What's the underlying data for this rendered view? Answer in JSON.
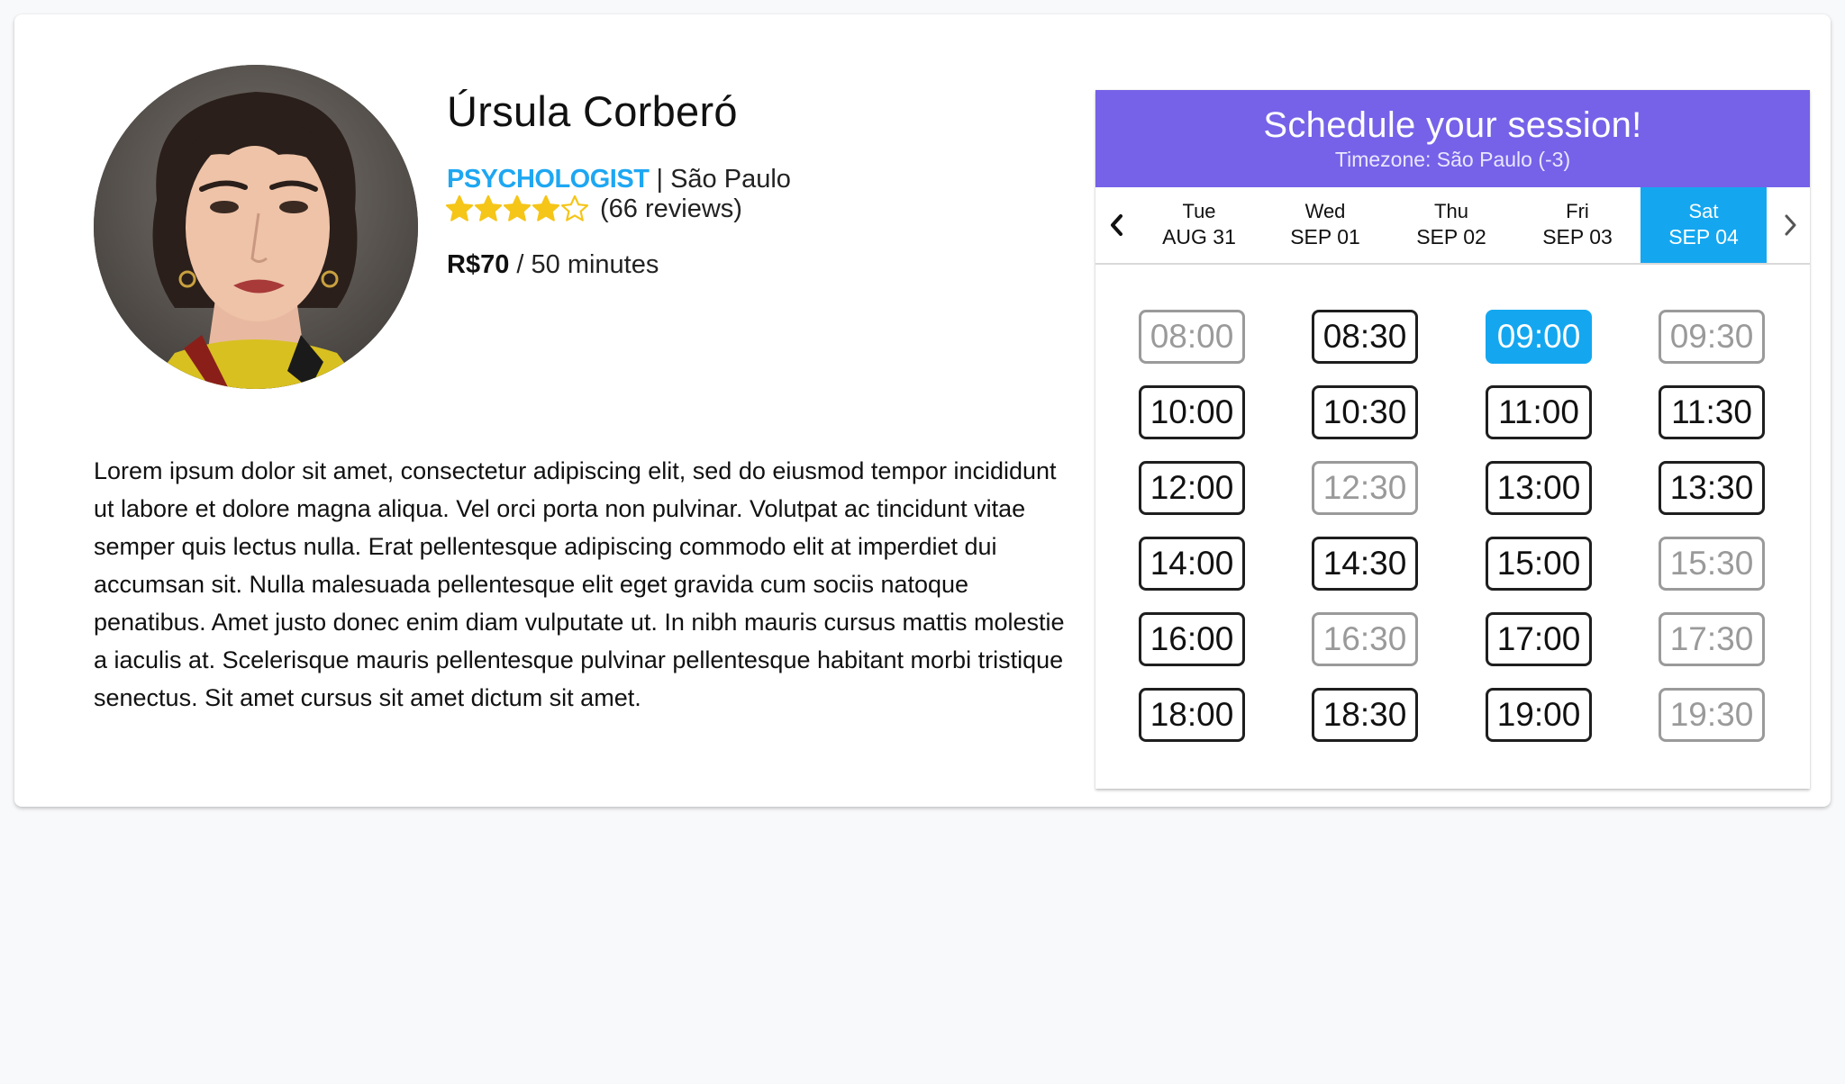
{
  "profile": {
    "name": "Úrsula Corberó",
    "profession": "PSYCHOLOGIST",
    "location_sep": " | ",
    "location": "São Paulo",
    "rating": 4,
    "rating_max": 5,
    "reviews": "(66 reviews)",
    "price": "R$70",
    "duration": " / 50 minutes",
    "bio": "Lorem ipsum dolor sit amet, consectetur adipiscing elit, sed do eiusmod tempor incididunt ut labore et dolore magna aliqua. Vel orci porta non pulvinar. Volutpat ac tincidunt vitae semper quis lectus nulla. Erat pellentesque adipiscing commodo elit at imperdiet dui accumsan sit. Nulla malesuada pellentesque elit eget gravida cum sociis natoque penatibus. Amet justo donec enim diam vulputate ut. In nibh mauris cursus mattis molestie a iaculis at. Scelerisque mauris pellentesque pulvinar pellentesque habitant morbi tristique senectus. Sit amet cursus sit amet dictum sit amet."
  },
  "scheduler": {
    "title": "Schedule your session!",
    "timezone": "Timezone: São Paulo (-3)",
    "prev_icon": "chevron-left-icon",
    "next_icon": "chevron-right-icon",
    "days": [
      {
        "dow": "Tue",
        "date": "AUG 31",
        "active": false
      },
      {
        "dow": "Wed",
        "date": "SEP 01",
        "active": false
      },
      {
        "dow": "Thu",
        "date": "SEP 02",
        "active": false
      },
      {
        "dow": "Fri",
        "date": "SEP 03",
        "active": false
      },
      {
        "dow": "Sat",
        "date": "SEP 04",
        "active": true
      }
    ],
    "slots": [
      {
        "time": "08:00",
        "state": "disabled"
      },
      {
        "time": "08:30",
        "state": "available"
      },
      {
        "time": "09:00",
        "state": "selected"
      },
      {
        "time": "09:30",
        "state": "disabled"
      },
      {
        "time": "10:00",
        "state": "available"
      },
      {
        "time": "10:30",
        "state": "available"
      },
      {
        "time": "11:00",
        "state": "available"
      },
      {
        "time": "11:30",
        "state": "available"
      },
      {
        "time": "12:00",
        "state": "available"
      },
      {
        "time": "12:30",
        "state": "disabled"
      },
      {
        "time": "13:00",
        "state": "available"
      },
      {
        "time": "13:30",
        "state": "available"
      },
      {
        "time": "14:00",
        "state": "available"
      },
      {
        "time": "14:30",
        "state": "available"
      },
      {
        "time": "15:00",
        "state": "available"
      },
      {
        "time": "15:30",
        "state": "disabled"
      },
      {
        "time": "16:00",
        "state": "available"
      },
      {
        "time": "16:30",
        "state": "disabled"
      },
      {
        "time": "17:00",
        "state": "available"
      },
      {
        "time": "17:30",
        "state": "disabled"
      },
      {
        "time": "18:00",
        "state": "available"
      },
      {
        "time": "18:30",
        "state": "available"
      },
      {
        "time": "19:00",
        "state": "available"
      },
      {
        "time": "19:30",
        "state": "disabled"
      }
    ]
  },
  "colors": {
    "accent": "#14a7f0",
    "header": "#7562e8",
    "star": "#f5c518",
    "disabled": "#9a9a9a"
  }
}
